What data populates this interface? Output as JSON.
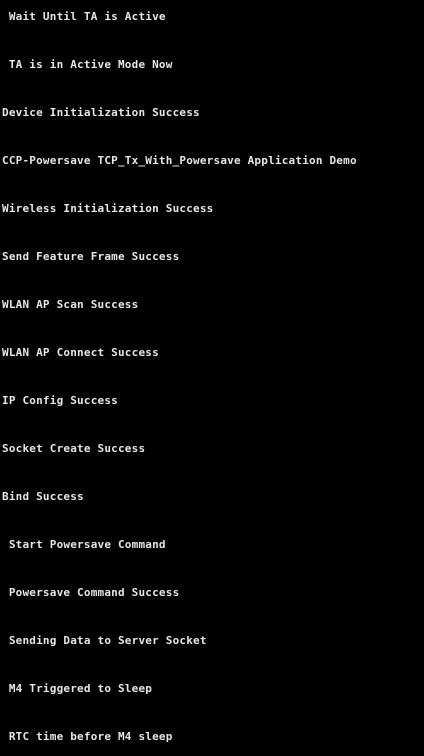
{
  "console": {
    "background": "#000000",
    "text_color": "#E6E6E6",
    "lines": [
      " Wait Until TA is Active",
      " TA is in Active Mode Now",
      "Device Initialization Success",
      "CCP-Powersave TCP_Tx_With_Powersave Application Demo",
      "Wireless Initialization Success",
      "Send Feature Frame Success",
      "WLAN AP Scan Success",
      "WLAN AP Connect Success",
      "IP Config Success",
      "Socket Create Success",
      "Bind Success",
      " Start Powersave Command",
      " Powersave Command Success",
      " Sending Data to Server Socket",
      " M4 Triggered to Sleep",
      " RTC time before M4 sleep"
    ]
  }
}
